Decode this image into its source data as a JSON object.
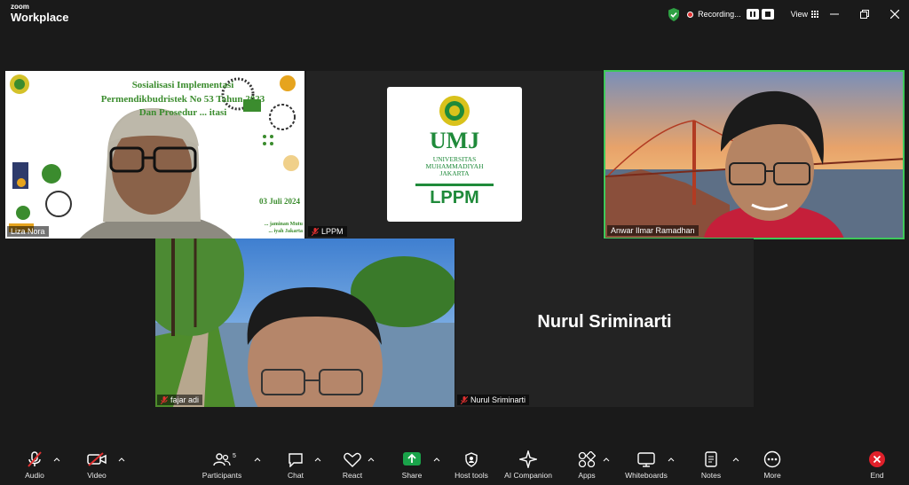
{
  "app": {
    "brand_line1": "zoom",
    "brand_line2": "Workplace"
  },
  "titlebar": {
    "recording_label": "Recording...",
    "view_label": "View"
  },
  "colors": {
    "recording": "#e03030",
    "shield": "#2ea043",
    "active_speaker_border": "#3ec95a",
    "umj_green": "#1f8a3a",
    "share_green": "#1aa34a",
    "end_red": "#e0202a"
  },
  "participants": [
    {
      "name": "Liza Nora",
      "muted": false
    },
    {
      "name": "LPPM",
      "muted": true
    },
    {
      "name": "Anwar Ilmar Ramadhan",
      "muted": false,
      "active_speaker": true
    },
    {
      "name": "fajar adi",
      "muted": true
    },
    {
      "name": "Nurul Sriminarti",
      "muted": true,
      "video_off": true
    }
  ],
  "slide": {
    "line1": "Sosialisasi  Implementasi",
    "line2": "Permendikbudristek No 53 Tahun 2023",
    "line3": "Dan Prosedur ... itasi",
    "date": "03 Juli 2024",
    "footer1": "... jaminan Mutu",
    "footer2": "... iyah Jakarta"
  },
  "lppm_logo": {
    "acronym": "UMJ",
    "univ_line1": "UNIVERSITAS",
    "univ_line2": "MUHAMMADIYAH",
    "univ_line3": "JAKARTA",
    "unit": "LPPM"
  },
  "toolbar": {
    "audio": "Audio",
    "video": "Video",
    "participants": "Participants",
    "participants_count": "5",
    "chat": "Chat",
    "react": "React",
    "share": "Share",
    "host_tools": "Host tools",
    "ai_companion": "AI Companion",
    "apps": "Apps",
    "whiteboards": "Whiteboards",
    "notes": "Notes",
    "more": "More",
    "end": "End"
  }
}
